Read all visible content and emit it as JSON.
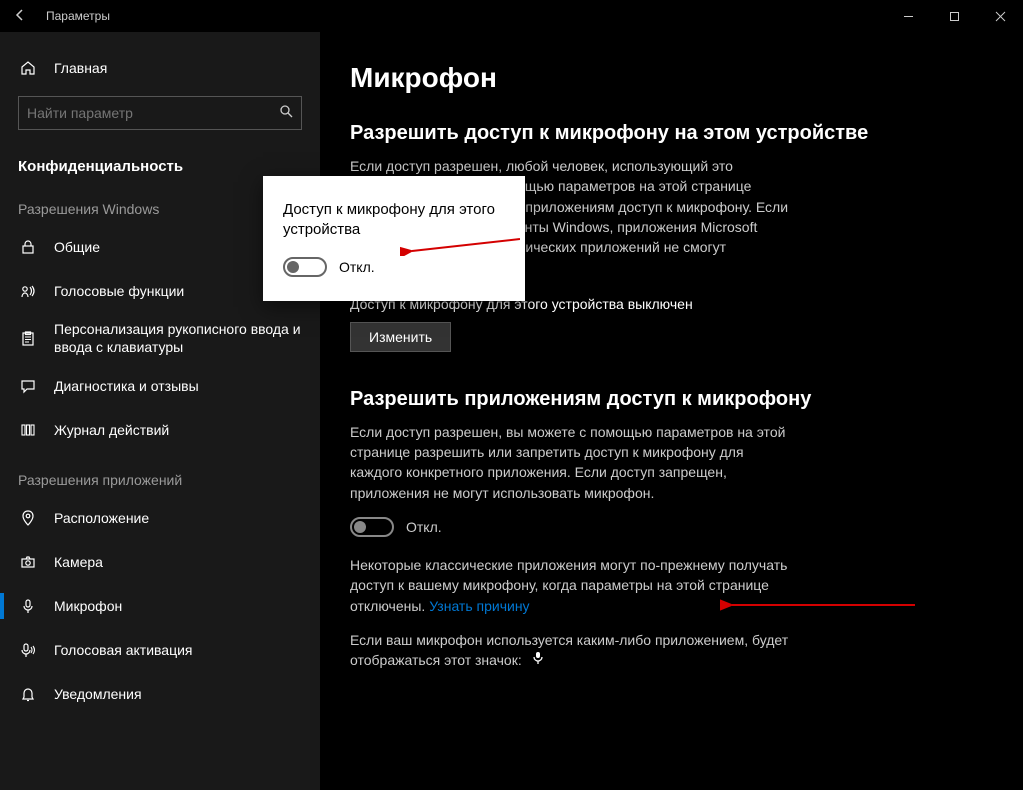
{
  "window": {
    "title": "Параметры"
  },
  "titlebar_buttons": {
    "min": "−",
    "max": "□",
    "close": "✕"
  },
  "sidebar": {
    "home_label": "Главная",
    "search_placeholder": "Найти параметр",
    "category": "Конфиденциальность",
    "group_windows": "Разрешения Windows",
    "items_windows": [
      {
        "icon": "lock-icon",
        "label": "Общие"
      },
      {
        "icon": "voice-icon",
        "label": "Голосовые функции"
      },
      {
        "icon": "clipboard-icon",
        "label": "Персонализация рукописного ввода и ввода с клавиатуры"
      },
      {
        "icon": "feedback-icon",
        "label": "Диагностика и отзывы"
      },
      {
        "icon": "history-icon",
        "label": "Журнал действий"
      }
    ],
    "group_apps": "Разрешения приложений",
    "items_apps": [
      {
        "icon": "location-icon",
        "label": "Расположение"
      },
      {
        "icon": "camera-icon",
        "label": "Камера"
      },
      {
        "icon": "mic-icon",
        "label": "Микрофон",
        "active": true
      },
      {
        "icon": "voice-act-icon",
        "label": "Голосовая активация"
      },
      {
        "icon": "bell-icon",
        "label": "Уведомления"
      }
    ]
  },
  "main": {
    "title": "Микрофон",
    "section1": {
      "title": "Разрешить доступ к микрофону на этом устройстве",
      "body": "Если доступ разрешен, любой человек, использующий это устройство, сможет с помощью параметров на этой странице разрешать или запрещать приложениям доступ к микрофону. Если доступ запрещен, компоненты Windows, приложения Microsoft Store и большинство классических приложений не смогут использовать микрофон.",
      "status": "Доступ к микрофону для этого устройства выключен",
      "button": "Изменить"
    },
    "section2": {
      "title": "Разрешить приложениям доступ к микрофону",
      "body": "Если доступ разрешен, вы можете с помощью параметров на этой странице разрешить или запретить доступ к микрофону для каждого конкретного приложения. Если доступ запрещен, приложения не могут использовать микрофон.",
      "toggle_label": "Откл.",
      "note1_a": "Некоторые классические приложения могут по-прежнему получать доступ к вашему микрофону, когда параметры на этой странице отключены. ",
      "note1_link": "Узнать причину",
      "note2": "Если ваш микрофон используется каким-либо приложением, будет отображаться этот значок: "
    }
  },
  "popup": {
    "title": "Доступ к микрофону для этого устройства",
    "toggle_label": "Откл."
  }
}
